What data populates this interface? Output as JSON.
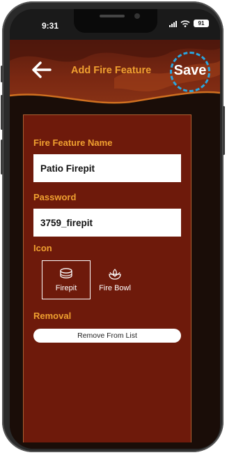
{
  "status_bar": {
    "time": "9:31",
    "battery": "91"
  },
  "header": {
    "title": "Add Fire Feature",
    "save_label": "Save",
    "back_icon": "arrow-left-icon"
  },
  "form": {
    "name_label": "Fire Feature Name",
    "name_value": "Patio Firepit",
    "password_label": "Password",
    "password_value": "3759_firepit",
    "icon_label": "Icon",
    "icons": [
      {
        "label": "Firepit",
        "icon": "firepit-icon",
        "selected": true
      },
      {
        "label": "Fire Bowl",
        "icon": "fire-bowl-icon",
        "selected": false
      }
    ],
    "removal_label": "Removal",
    "remove_button": "Remove From List"
  },
  "colors": {
    "accent": "#f0a030",
    "panel": "#6e1a0b",
    "highlight": "#2aa7e0"
  }
}
